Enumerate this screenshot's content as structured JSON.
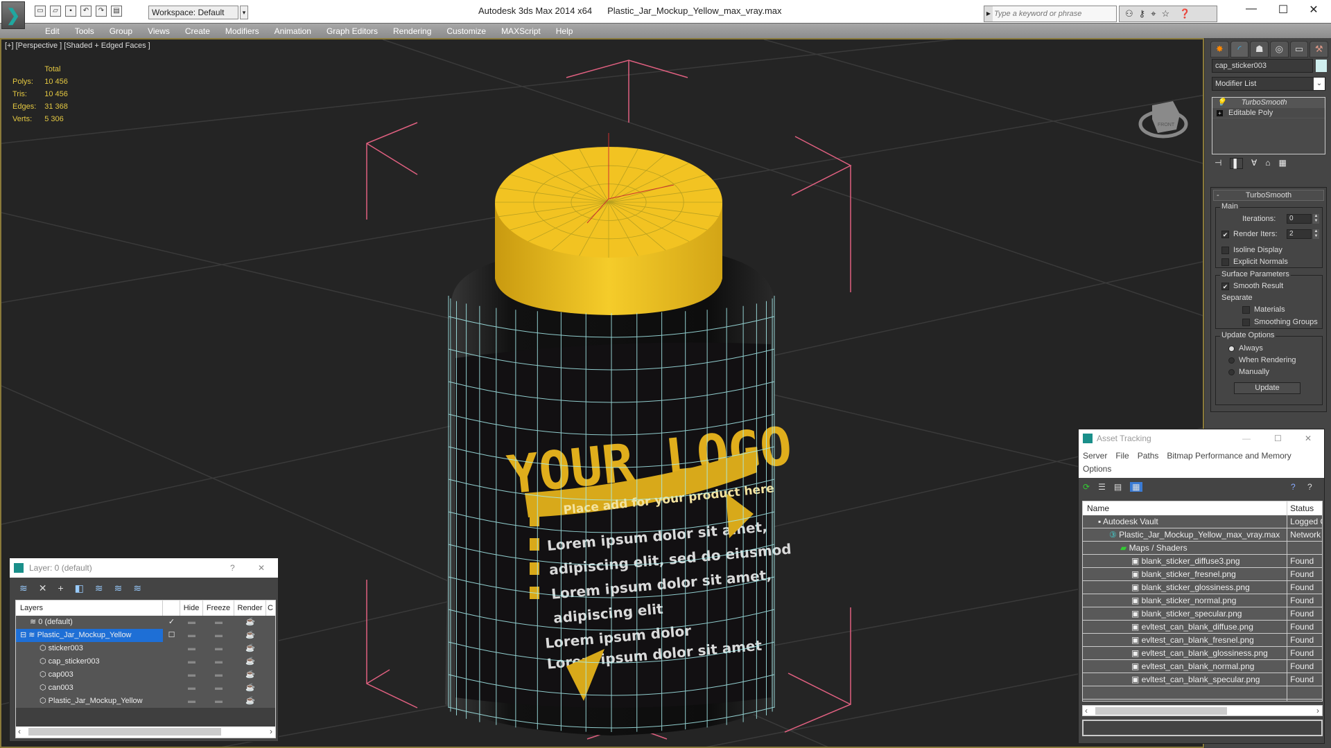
{
  "titlebar": {
    "app_title": "Autodesk 3ds Max  2014 x64",
    "file_title": "Plastic_Jar_Mockup_Yellow_max_vray.max",
    "workspace": "Workspace: Default",
    "search_placeholder": "Type a keyword or phrase",
    "minimize": "—",
    "maximize": "☐",
    "close": "✕"
  },
  "menu": [
    "Edit",
    "Tools",
    "Group",
    "Views",
    "Create",
    "Modifiers",
    "Animation",
    "Graph Editors",
    "Rendering",
    "Customize",
    "MAXScript",
    "Help"
  ],
  "viewport": {
    "label": "[+] [Perspective ] [Shaded + Edged Faces ]",
    "stats_header": "Total",
    "stats": [
      {
        "label": "Polys:",
        "value": "10 456"
      },
      {
        "label": "Tris:",
        "value": "10 456"
      },
      {
        "label": "Edges:",
        "value": "31 368"
      },
      {
        "label": "Verts:",
        "value": "5 306"
      }
    ],
    "viewcube_label": "FRONT",
    "jar_label": {
      "logo": "YOUR LOGO",
      "tagline": "Place add for your product here",
      "body_lines": [
        "Lorem ipsum dolor sit amet,",
        "adipiscing elit, sed do eiusmod",
        "Lorem ipsum dolor sit amet,",
        "adipiscing elit"
      ],
      "footer_lines": [
        "Lorem ipsum dolor",
        "Lorem ipsum dolor sit amet"
      ]
    },
    "colors": {
      "cap": "#f2c322",
      "wire": "#a8f0f0",
      "selection_box": "#e06080"
    }
  },
  "command_panel": {
    "object_name": "cap_sticker003",
    "object_color": "#cfeeee",
    "modifier_list": "Modifier List",
    "stack": [
      {
        "label": "TurboSmooth",
        "icon": "lightbulb-icon"
      },
      {
        "label": "Editable Poly",
        "icon": "plus-icon"
      }
    ],
    "rollout_title": "TurboSmooth",
    "main_group": "Main",
    "iterations_label": "Iterations:",
    "iterations_value": "0",
    "render_iters_label": "Render Iters:",
    "render_iters_value": "2",
    "render_iters_checked": true,
    "isoline_display": "Isoline Display",
    "explicit_normals": "Explicit Normals",
    "surface_group": "Surface Parameters",
    "smooth_result": "Smooth Result",
    "separate": "Separate",
    "materials": "Materials",
    "smoothing_groups": "Smoothing Groups",
    "update_group": "Update Options",
    "update_options": [
      "Always",
      "When Rendering",
      "Manually"
    ],
    "update_selected": "Always",
    "update_button": "Update"
  },
  "asset_tracking": {
    "title": "Asset Tracking",
    "menu": [
      "Server",
      "File",
      "Paths",
      "Bitmap Performance and Memory",
      "Options"
    ],
    "columns": [
      "Name",
      "Status"
    ],
    "rows": [
      {
        "name": "Autodesk Vault",
        "status": "Logged O",
        "indent": 1
      },
      {
        "name": "Plastic_Jar_Mockup_Yellow_max_vray.max",
        "status": "Network",
        "indent": 2
      },
      {
        "name": "Maps / Shaders",
        "status": "",
        "indent": 3
      },
      {
        "name": "blank_sticker_diffuse3.png",
        "status": "Found",
        "indent": 4
      },
      {
        "name": "blank_sticker_fresnel.png",
        "status": "Found",
        "indent": 4
      },
      {
        "name": "blank_sticker_glossiness.png",
        "status": "Found",
        "indent": 4
      },
      {
        "name": "blank_sticker_normal.png",
        "status": "Found",
        "indent": 4
      },
      {
        "name": "blank_sticker_specular.png",
        "status": "Found",
        "indent": 4
      },
      {
        "name": "evltest_can_blank_diffuse.png",
        "status": "Found",
        "indent": 4
      },
      {
        "name": "evltest_can_blank_fresnel.png",
        "status": "Found",
        "indent": 4
      },
      {
        "name": "evltest_can_blank_glossiness.png",
        "status": "Found",
        "indent": 4
      },
      {
        "name": "evltest_can_blank_normal.png",
        "status": "Found",
        "indent": 4
      },
      {
        "name": "evltest_can_blank_specular.png",
        "status": "Found",
        "indent": 4
      }
    ]
  },
  "layer_dialog": {
    "title": "Layer: 0 (default)",
    "help": "?",
    "close": "✕",
    "columns": [
      "Layers",
      "",
      "Hide",
      "Freeze",
      "Render",
      "C"
    ],
    "rows": [
      {
        "name": "0 (default)",
        "current": "✓",
        "indent": 1,
        "selected": false
      },
      {
        "name": "Plastic_Jar_Mockup_Yellow",
        "current": "☐",
        "indent": 0,
        "selected": true
      },
      {
        "name": "sticker003",
        "current": "",
        "indent": 2,
        "selected": false
      },
      {
        "name": "cap_sticker003",
        "current": "",
        "indent": 2,
        "selected": false
      },
      {
        "name": "cap003",
        "current": "",
        "indent": 2,
        "selected": false
      },
      {
        "name": "can003",
        "current": "",
        "indent": 2,
        "selected": false
      },
      {
        "name": "Plastic_Jar_Mockup_Yellow",
        "current": "",
        "indent": 2,
        "selected": false
      }
    ]
  }
}
